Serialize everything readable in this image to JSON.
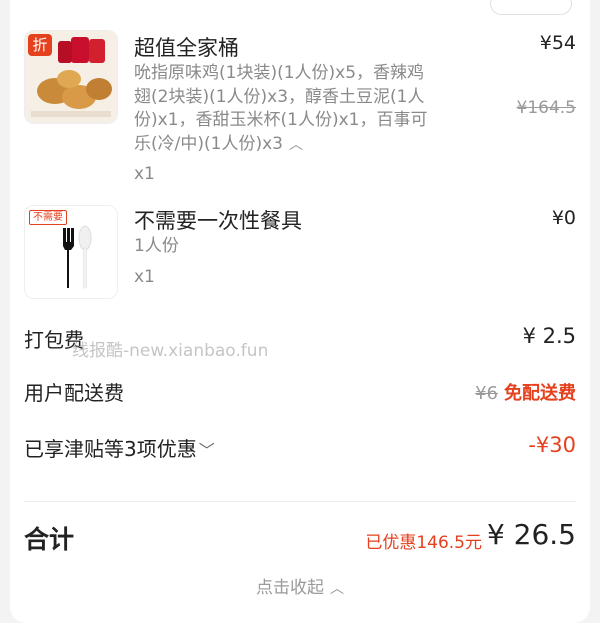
{
  "items": [
    {
      "name": "超值全家桶",
      "price": "¥54",
      "original_price": "¥164.5",
      "badge": "折",
      "desc_lines": [
        "吮指原味鸡(1块装)(1人份)x5，香辣鸡",
        "翅(2块装)(1人份)x3，醇香土豆泥(1人",
        "份)x1，香甜玉米杯(1人份)x1，百事可",
        "乐(冷/中)(1人份)x3"
      ],
      "qty": "x1"
    },
    {
      "name": "不需要一次性餐具",
      "price": "¥0",
      "badge": "不需要",
      "desc": "1人份",
      "qty": "x1"
    }
  ],
  "fees": {
    "packing_label": "打包费",
    "packing_value": "¥ 2.5",
    "delivery_label": "用户配送费",
    "delivery_original": "¥6",
    "delivery_free": "免配送费",
    "discount_label": "已享津贴等3项优惠",
    "discount_value": "-¥30"
  },
  "total": {
    "label": "合计",
    "saved": "已优惠146.5元",
    "amount": "¥ 26.5"
  },
  "collapse_label": "点击收起",
  "watermark": "线报酷-new.xianbao.fun",
  "colors": {
    "accent": "#e5411e",
    "muted": "#8a8a8a"
  }
}
